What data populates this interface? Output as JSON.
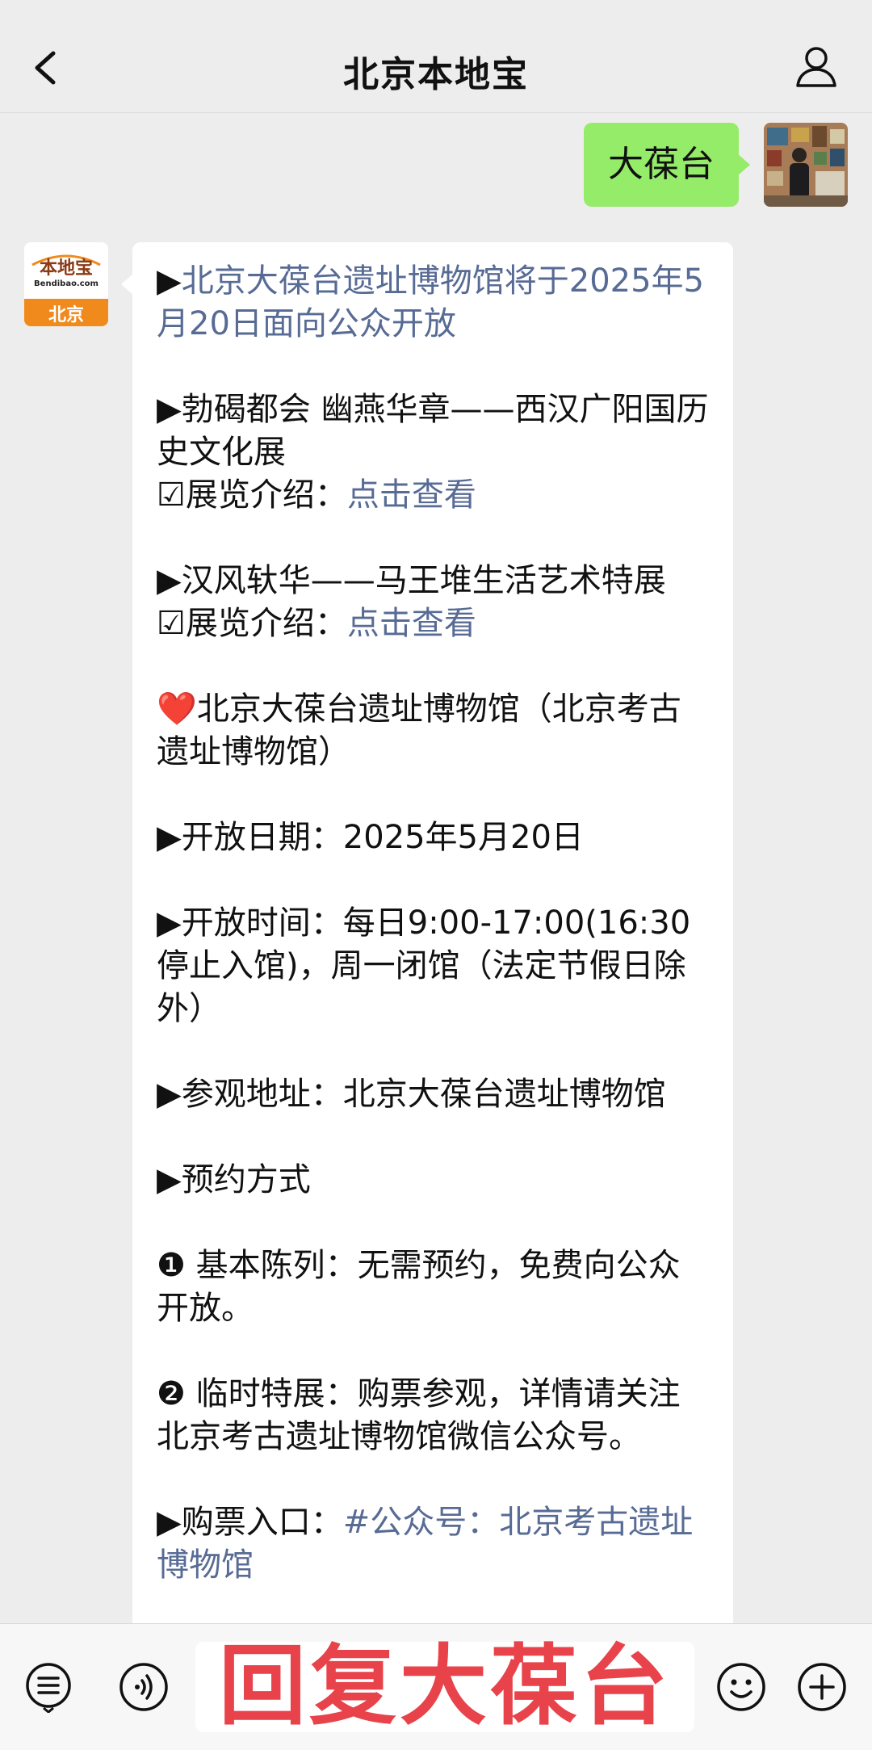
{
  "header": {
    "title": "北京本地宝",
    "back_icon": "chevron-left-icon",
    "profile_icon": "person-icon"
  },
  "outgoing": {
    "text": "大葆台"
  },
  "incoming": {
    "avatar": {
      "logo_text": "本地宝",
      "domain": "Bendibao.com",
      "city": "北京",
      "color": "#f08a1c"
    },
    "p1_arrow": "▶",
    "p1_link": "北京大葆台遗址博物馆将于2025年5月20日面向公众开放",
    "p2": "▶勃碣都会 幽燕华章——西汉广阳国历史文化展",
    "p2_intro": "☑展览介绍：",
    "p2_link": "点击查看",
    "p3": "▶汉风轪华——马王堆生活艺术特展",
    "p3_intro": "☑展览介绍：",
    "p3_link": "点击查看",
    "p4_heart": "❤️",
    "p4": "北京大葆台遗址博物馆（北京考古遗址博物馆）",
    "p5": "▶开放日期：2025年5月20日",
    "p6": "▶开放时间：每日9:00-17:00(16:30停止入馆)，周一闭馆（法定节假日除外）",
    "p7": "▶参观地址：北京大葆台遗址博物馆",
    "p8": "▶预约方式",
    "p9": "❶ 基本陈列：无需预约，免费向公众开放。",
    "p10": "❷ 临时特展：购票参观，详情请关注北京考古遗址博物馆微信公众号。",
    "p11": "▶购票入口：",
    "p11_link": "#公众号：北京考古遗址博物馆"
  },
  "toolbar": {
    "input_text": "回复大葆台",
    "list_icon": "menu-list-icon",
    "voice_icon": "voice-icon",
    "emoji_icon": "emoji-icon",
    "plus_icon": "plus-icon"
  },
  "colors": {
    "outgoing_bubble": "#95ec69",
    "link": "#576b95",
    "input_text": "#e8434a"
  }
}
